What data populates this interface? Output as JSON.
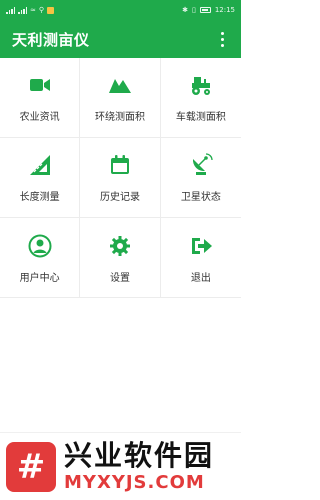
{
  "statusbar": {
    "time": "12:15",
    "battery_text": ""
  },
  "appbar": {
    "title": "天利测亩仪"
  },
  "menu": [
    {
      "label": "农业资讯",
      "icon": "video-camera-icon"
    },
    {
      "label": "环绕测面积",
      "icon": "mountain-icon"
    },
    {
      "label": "车载测面积",
      "icon": "tractor-icon"
    },
    {
      "label": "长度测量",
      "icon": "ruler-icon"
    },
    {
      "label": "历史记录",
      "icon": "calendar-icon"
    },
    {
      "label": "卫星状态",
      "icon": "satellite-dish-icon"
    },
    {
      "label": "用户中心",
      "icon": "user-circle-icon"
    },
    {
      "label": "设置",
      "icon": "gear-icon"
    },
    {
      "label": "退出",
      "icon": "exit-icon"
    }
  ],
  "banner": {
    "brand_cn": "兴业软件园",
    "brand_en": "MYXYJS.COM",
    "logo_text": "#"
  },
  "colors": {
    "primary": "#1faa4b",
    "text": "#333333",
    "brand_red": "#e23b3b"
  }
}
